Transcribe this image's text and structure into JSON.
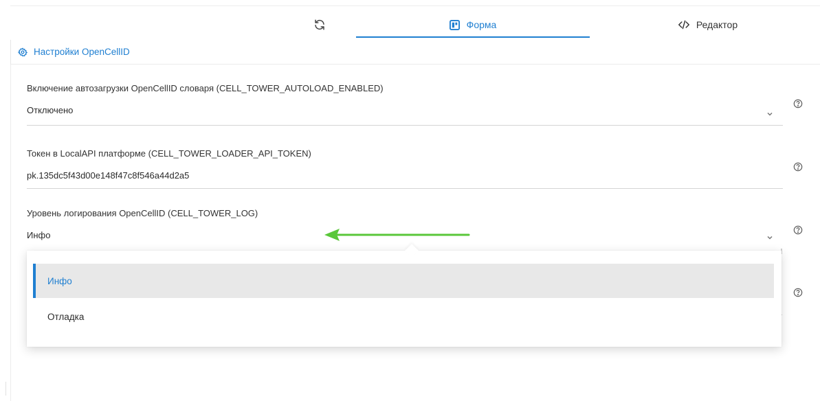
{
  "tabs": {
    "refresh_icon": "refresh-icon",
    "form_label": "Форма",
    "editor_label": "Редактор"
  },
  "section": {
    "title": "Настройки OpenCellID"
  },
  "fields": [
    {
      "label": "Включение автозагрузки OpenCellID словаря (CELL_TOWER_AUTOLOAD_ENABLED)",
      "value": "Отключено"
    },
    {
      "label": "Токен в LocalAPI платформе (CELL_TOWER_LOADER_API_TOKEN)",
      "value": "pk.135dc5f43d00e148f47c8f546a44d2a5"
    },
    {
      "label": "Уровень логирования OpenCellID (CELL_TOWER_LOG)",
      "value": "Инфо"
    }
  ],
  "dropdown": {
    "options": [
      "Инфо",
      "Отладка"
    ],
    "selected": "Инфо"
  },
  "colors": {
    "accent": "#1f7fd1",
    "arrow": "#5ac73a",
    "selected_bg": "#e8e8e8"
  }
}
